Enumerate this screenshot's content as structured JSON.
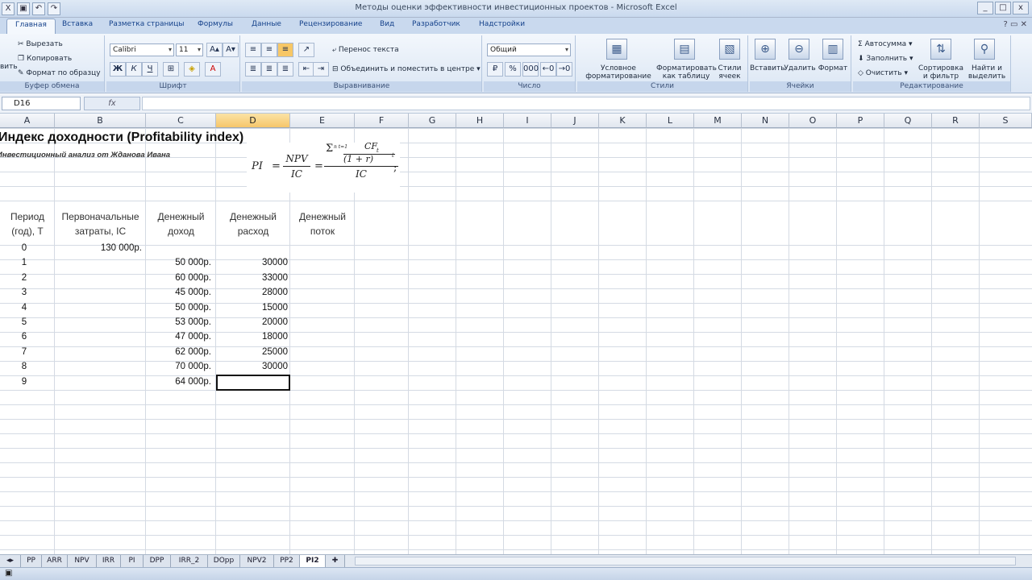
{
  "window": {
    "title": "Методы оценки эффективности инвестиционных проектов - Microsoft Excel",
    "qat_icons": [
      "excel-icon",
      "save-icon",
      "undo-icon",
      "redo-icon"
    ],
    "controls": [
      "_",
      "□",
      "x"
    ]
  },
  "ribbon": {
    "tabs": [
      "Главная",
      "Вставка",
      "Разметка страницы",
      "Формулы",
      "Данные",
      "Рецензирование",
      "Вид",
      "Разработчик",
      "Надстройки"
    ],
    "active_tab": "Главная",
    "clipboard": {
      "cut": "Вырезать",
      "copy": "Копировать",
      "format_painter": "Формат по образцу",
      "paste": "вить",
      "label": "Буфер обмена"
    },
    "font": {
      "name": "Calibri",
      "size": "11",
      "label": "Шрифт",
      "bold": "Ж",
      "italic": "К",
      "underline": "Ч"
    },
    "alignment": {
      "wrap": "Перенос текста",
      "merge": "Объединить и поместить в центре",
      "label": "Выравнивание"
    },
    "number": {
      "format": "Общий",
      "label": "Число",
      "percent": "%",
      "thousands": "000"
    },
    "styles": {
      "conditional": "Условное форматирование",
      "as_table": "Форматировать как таблицу",
      "cell_styles": "Стили ячеек",
      "label": "Стили"
    },
    "cells": {
      "insert": "Вставить",
      "delete": "Удалить",
      "format": "Формат",
      "label": "Ячейки"
    },
    "editing": {
      "autosum": "Автосумма",
      "fill": "Заполнить",
      "clear": "Очистить",
      "sort": "Сортировка и фильтр",
      "find": "Найти и выделить",
      "label": "Редактирование"
    }
  },
  "formula_bar": {
    "name_box": "D16",
    "fx": "fx",
    "content": ""
  },
  "columns": [
    "A",
    "B",
    "C",
    "D",
    "E",
    "F",
    "G",
    "H",
    "I",
    "J",
    "K",
    "L",
    "M",
    "N",
    "O",
    "P",
    "Q",
    "R",
    "S"
  ],
  "selected_column": "D",
  "sheet": {
    "title": "Индекс доходности (Profitability index)",
    "subtitle": "Инвестиционный анализ от Жданова Ивана",
    "formula": {
      "lhs": "PI",
      "eq": "=",
      "npv": "NPV",
      "ic": "IC",
      "sum": "Σ",
      "sum_limits": "n t=1",
      "cf": "CF",
      "cf_sub": "t",
      "denom": "(1 + r)",
      "denom_sup": "t",
      "ic2": "IC",
      "end": ";"
    },
    "headers": {
      "period": [
        "Период",
        "(год), Т"
      ],
      "initial": [
        "Первоначальные",
        "затраты, IC"
      ],
      "income": [
        "Денежный",
        "доход"
      ],
      "expense": [
        "Денежный",
        "расход"
      ],
      "flow": [
        "Денежный",
        "поток"
      ]
    },
    "rows": [
      {
        "period": "0",
        "initial": "130 000р.",
        "income": "",
        "expense": ""
      },
      {
        "period": "1",
        "initial": "",
        "income": "50 000р.",
        "expense": "30000"
      },
      {
        "period": "2",
        "initial": "",
        "income": "60 000р.",
        "expense": "33000"
      },
      {
        "period": "3",
        "initial": "",
        "income": "45 000р.",
        "expense": "28000"
      },
      {
        "period": "4",
        "initial": "",
        "income": "50 000р.",
        "expense": "15000"
      },
      {
        "period": "5",
        "initial": "",
        "income": "53 000р.",
        "expense": "20000"
      },
      {
        "period": "6",
        "initial": "",
        "income": "47 000р.",
        "expense": "18000"
      },
      {
        "period": "7",
        "initial": "",
        "income": "62 000р.",
        "expense": "25000"
      },
      {
        "period": "8",
        "initial": "",
        "income": "70 000р.",
        "expense": "30000"
      },
      {
        "period": "9",
        "initial": "",
        "income": "64 000р.",
        "expense": ""
      }
    ]
  },
  "sheet_tabs": [
    "PP",
    "ARR",
    "NPV",
    "IRR",
    "PI",
    "DPP",
    "IRR_2",
    "DOpp",
    "NPV2",
    "PP2",
    "PI2"
  ],
  "active_sheet_tab": "PI2"
}
